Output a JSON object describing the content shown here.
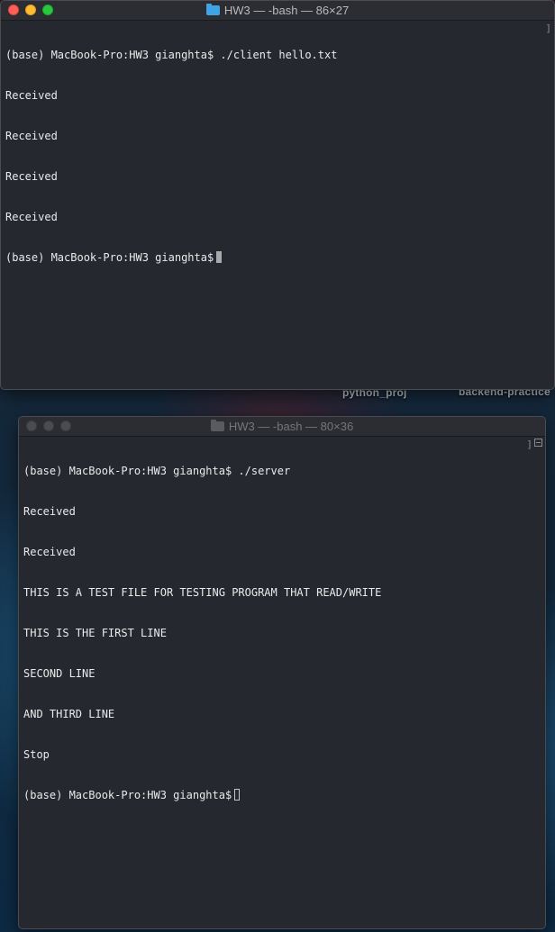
{
  "desktop": {
    "labels": [
      "python_proj",
      "backend-practice"
    ]
  },
  "window_top": {
    "title": "HW3 — -bash — 86×27",
    "lines": [
      "(base) MacBook-Pro:HW3 gianghta$ ./client hello.txt",
      "Received",
      "Received",
      "Received",
      "Received"
    ],
    "prompt": "(base) MacBook-Pro:HW3 gianghta$"
  },
  "window_bottom": {
    "title": "HW3 — -bash — 80×36",
    "lines": [
      "(base) MacBook-Pro:HW3 gianghta$ ./server",
      "Received",
      "Received",
      "THIS IS A TEST FILE FOR TESTING PROGRAM THAT READ/WRITE",
      "THIS IS THE FIRST LINE",
      "SECOND LINE",
      "AND THIRD LINE",
      "Stop"
    ],
    "prompt": "(base) MacBook-Pro:HW3 gianghta$"
  },
  "icons": {
    "folder": "folder-icon",
    "close": "close-button",
    "minimize": "minimize-button",
    "zoom": "zoom-button"
  },
  "colors": {
    "close": "#fe5f57",
    "minimize": "#febc2e",
    "zoom": "#28c840",
    "terminal_bg": "#262830",
    "terminal_text": "#eaeaea"
  }
}
